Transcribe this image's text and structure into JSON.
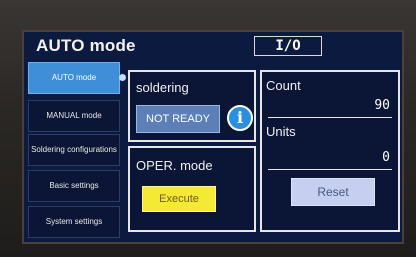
{
  "header": {
    "title": "AUTO mode",
    "io_indicator": "I/O"
  },
  "sidebar": {
    "items": [
      {
        "label": "AUTO mode",
        "active": true
      },
      {
        "label": "MANUAL mode",
        "active": false
      },
      {
        "label": "Soldering configurations",
        "active": false
      },
      {
        "label": "Basic settings",
        "active": false
      },
      {
        "label": "System settings",
        "active": false
      }
    ]
  },
  "soldering": {
    "label": "soldering",
    "status": "NOT READY",
    "info_icon": "info-icon"
  },
  "operation": {
    "label": "OPER. mode",
    "execute_label": "Execute"
  },
  "counters": {
    "count_label": "Count",
    "count_value": "90",
    "units_label": "Units",
    "units_value": "0",
    "reset_label": "Reset"
  },
  "colors": {
    "screen_bg": "#0d1a3f",
    "active_nav": "#3f8ed8",
    "execute": "#f4ea34",
    "reset": "#c6cff0",
    "status": "#5b7fb6"
  }
}
